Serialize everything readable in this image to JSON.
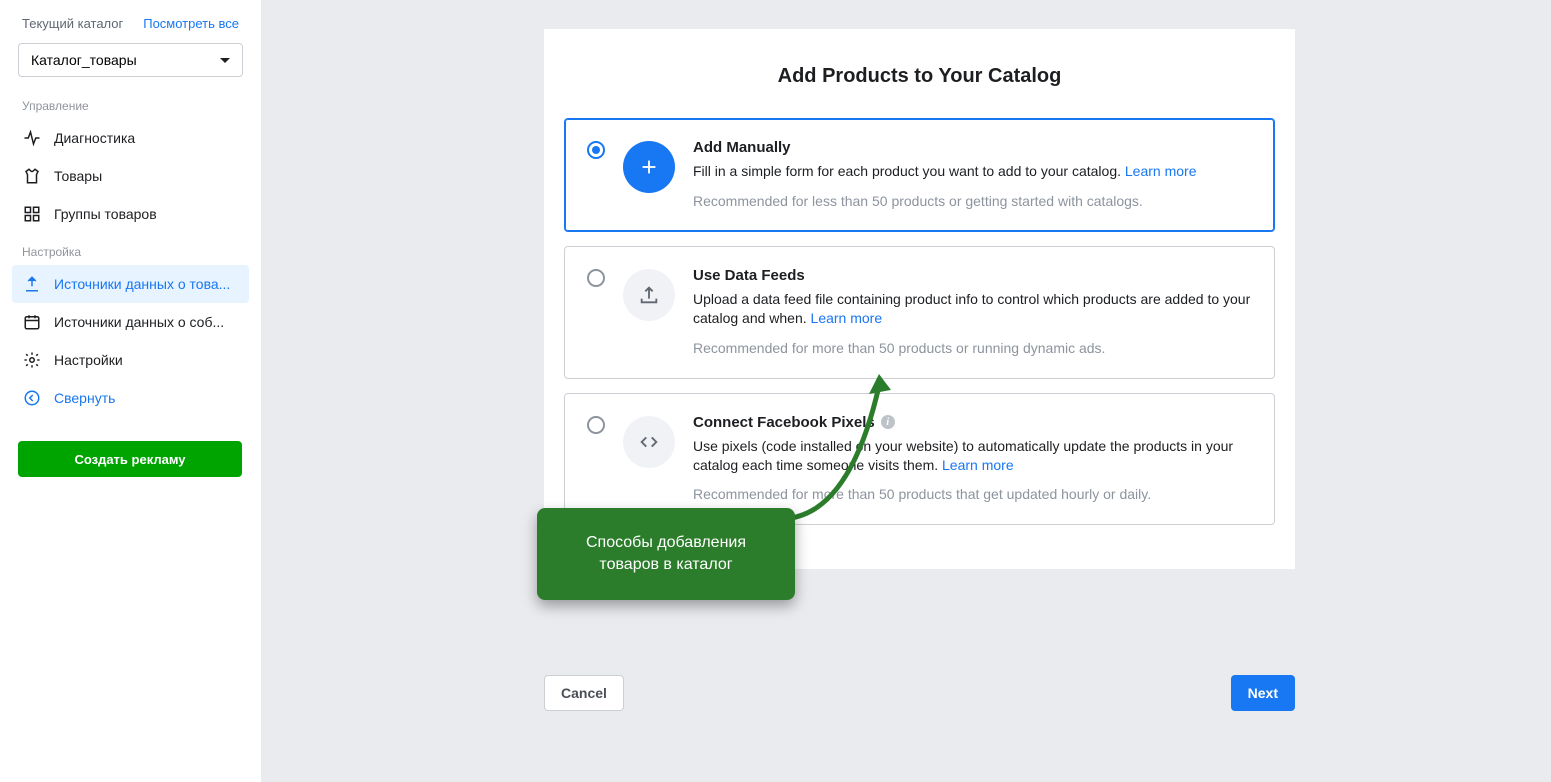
{
  "sidebar": {
    "currentLabel": "Текущий каталог",
    "viewAll": "Посмотреть все",
    "catalogName": "Каталог_товары",
    "sectionManage": "Управление",
    "sectionSetup": "Настройка",
    "items": {
      "diagnostics": "Диагностика",
      "products": "Товары",
      "productGroups": "Группы товаров",
      "dataSourcesProducts": "Источники данных о това...",
      "dataSourcesEvents": "Источники данных о соб...",
      "settings": "Настройки",
      "collapse": "Свернуть"
    },
    "createAd": "Создать рекламу"
  },
  "panel": {
    "title": "Add Products to Your Catalog",
    "options": [
      {
        "key": "manual",
        "title": "Add Manually",
        "desc": "Fill in a simple form for each product you want to add to your catalog. ",
        "learnMore": "Learn more",
        "reco": "Recommended for less than 50 products or getting started with catalogs.",
        "selected": true
      },
      {
        "key": "feeds",
        "title": "Use Data Feeds",
        "desc": "Upload a data feed file containing product info to control which products are added to your catalog and when. ",
        "learnMore": "Learn more",
        "reco": "Recommended for more than 50 products or running dynamic ads.",
        "selected": false
      },
      {
        "key": "pixels",
        "title": "Connect Facebook Pixels",
        "desc": "Use pixels (code installed on your website) to automatically update the products in your catalog each time someone visits them. ",
        "learnMore": "Learn more",
        "reco": "Recommended for more than 50 products that get updated hourly or daily.",
        "selected": false,
        "hasInfo": true
      }
    ]
  },
  "footer": {
    "cancel": "Cancel",
    "next": "Next"
  },
  "callout": "Способы добавления товаров в каталог"
}
